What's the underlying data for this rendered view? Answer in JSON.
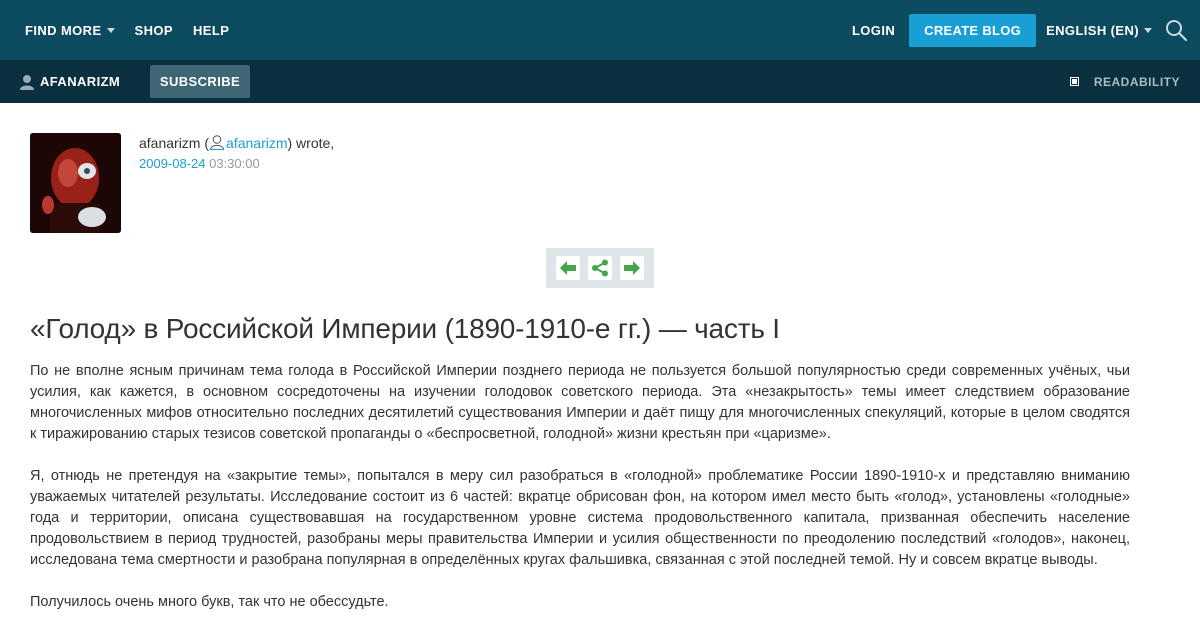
{
  "topnav": {
    "find_more": "FIND MORE",
    "shop": "SHOP",
    "help": "HELP",
    "login": "LOGIN",
    "create_blog": "CREATE BLOG",
    "language": "ENGLISH (EN)",
    "search_icon": "search-icon"
  },
  "subnav": {
    "username": "AFANARIZM",
    "subscribe": "SUBSCRIBE",
    "readability": "READABILITY"
  },
  "post": {
    "author_name": "afanarizm",
    "author_link": "afanarizm",
    "open_paren": " (",
    "wrote": ") wrote,",
    "date": "2009-08-24",
    "time": " 03:30:00",
    "title": "«Голод» в Российской Империи (1890-1910-е гг.) — часть I",
    "paragraphs": [
      "По не вполне ясным причинам тема голода в Российской Империи позднего периода не пользуется большой популярностью среди современных учёных, чьи усилия, как кажется, в основном сосредоточены на изучении голодовок советского периода. Эта «незакрытость» темы имеет следствием образование многочисленных мифов относительно последних десятилетий существования Империи и даёт пищу для многочисленных спекуляций, которые в целом сводятся к тиражированию старых тезисов советской пропаганды о «беспросветной, голодной» жизни крестьян при «царизме».",
      "Я, отнюдь не претендуя на «закрытие темы», попытался в меру сил разобраться в «голодной» проблематике России 1890-1910-х и представляю вниманию уважаемых читателей результаты. Исследование состоит из 6 частей: вкратце обрисован фон, на котором имел место быть «голод», установлены «голодные» года и территории, описана существовавшая на государственном уровне система продовольственного капитала, призванная обеспечить население продовольствием в период трудностей, разобраны меры правительства Империи и усилия общественности по преодолению последствий «голодов», наконец, исследована тема смертности и разобрана популярная в определённых кругах фальшивка, связанная с этой последней темой. Ну и совсем вкратце выводы.",
      "Получилось очень много букв, так что не обессудьте."
    ]
  },
  "colors": {
    "topbar": "#0c4a60",
    "subbar": "#0a2f3e",
    "accent": "#1a9fd4"
  }
}
